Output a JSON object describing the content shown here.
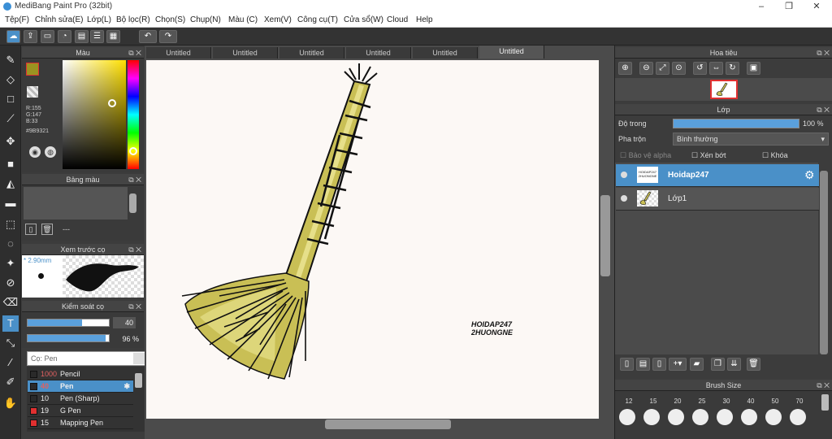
{
  "title": "MediBang Paint Pro (32bit)",
  "menu": [
    "Tệp(F)",
    "Chỉnh sửa(E)",
    "Lớp(L)",
    "Bộ lọc(R)",
    "Chọn(S)",
    "Chụp(N)",
    "Màu (C)",
    "Xem(V)",
    "Công cụ(T)",
    "Cửa sổ(W)",
    "Cloud",
    "Help"
  ],
  "tabs": [
    "Untitled",
    "Untitled",
    "Untitled",
    "Untitled",
    "Untitled",
    "Untitled"
  ],
  "color_panel": {
    "title": "Màu",
    "r": "R:155",
    "g": "G:147",
    "b": "B:33",
    "hex": "#9B9321",
    "fg": "#9b9321",
    "accent": "#9b9321"
  },
  "palette": {
    "title": "Bảng màu",
    "label": "---"
  },
  "brush_preview": {
    "title": "Xem trước cọ",
    "size": "2.90mm"
  },
  "brush_control": {
    "title": "Kiểm soát cọ",
    "size_value": "40",
    "opacity_value": "96 %",
    "size": 40,
    "opacity": 96
  },
  "brush_list": {
    "label": "Cọ: Pen",
    "items": [
      {
        "size": "1000",
        "name": "Pencil",
        "color": "#2a2a2a"
      },
      {
        "size": "40",
        "name": "Pen",
        "color": "#2a2a2a"
      },
      {
        "size": "10",
        "name": "Pen (Sharp)",
        "color": "#2a2a2a"
      },
      {
        "size": "19",
        "name": "G Pen",
        "color": "#e03030"
      },
      {
        "size": "15",
        "name": "Mapping Pen",
        "color": "#e03030"
      }
    ]
  },
  "canvas_text": {
    "line1": "HOIDAP247",
    "line2": "2HUONGNE"
  },
  "navigator": {
    "title": "Hoa tiêu"
  },
  "layers": {
    "title": "Lớp",
    "opacity_label": "Độ trong",
    "opacity_value": "100 %",
    "opacity": 100,
    "blend_label": "Pha trộn",
    "blend_value": "Bình thường",
    "protect_alpha": "Bảo vệ alpha",
    "clipping": "Xén bớt",
    "lock": "Khóa",
    "items": [
      {
        "name": "Hoidap247",
        "thumb": "HOIDAP247 2HUONGNE"
      },
      {
        "name": "Lớp1"
      }
    ]
  },
  "brush_size": {
    "title": "Brush Size",
    "sizes": [
      "12",
      "15",
      "20",
      "25",
      "30",
      "40",
      "50",
      "70"
    ]
  }
}
